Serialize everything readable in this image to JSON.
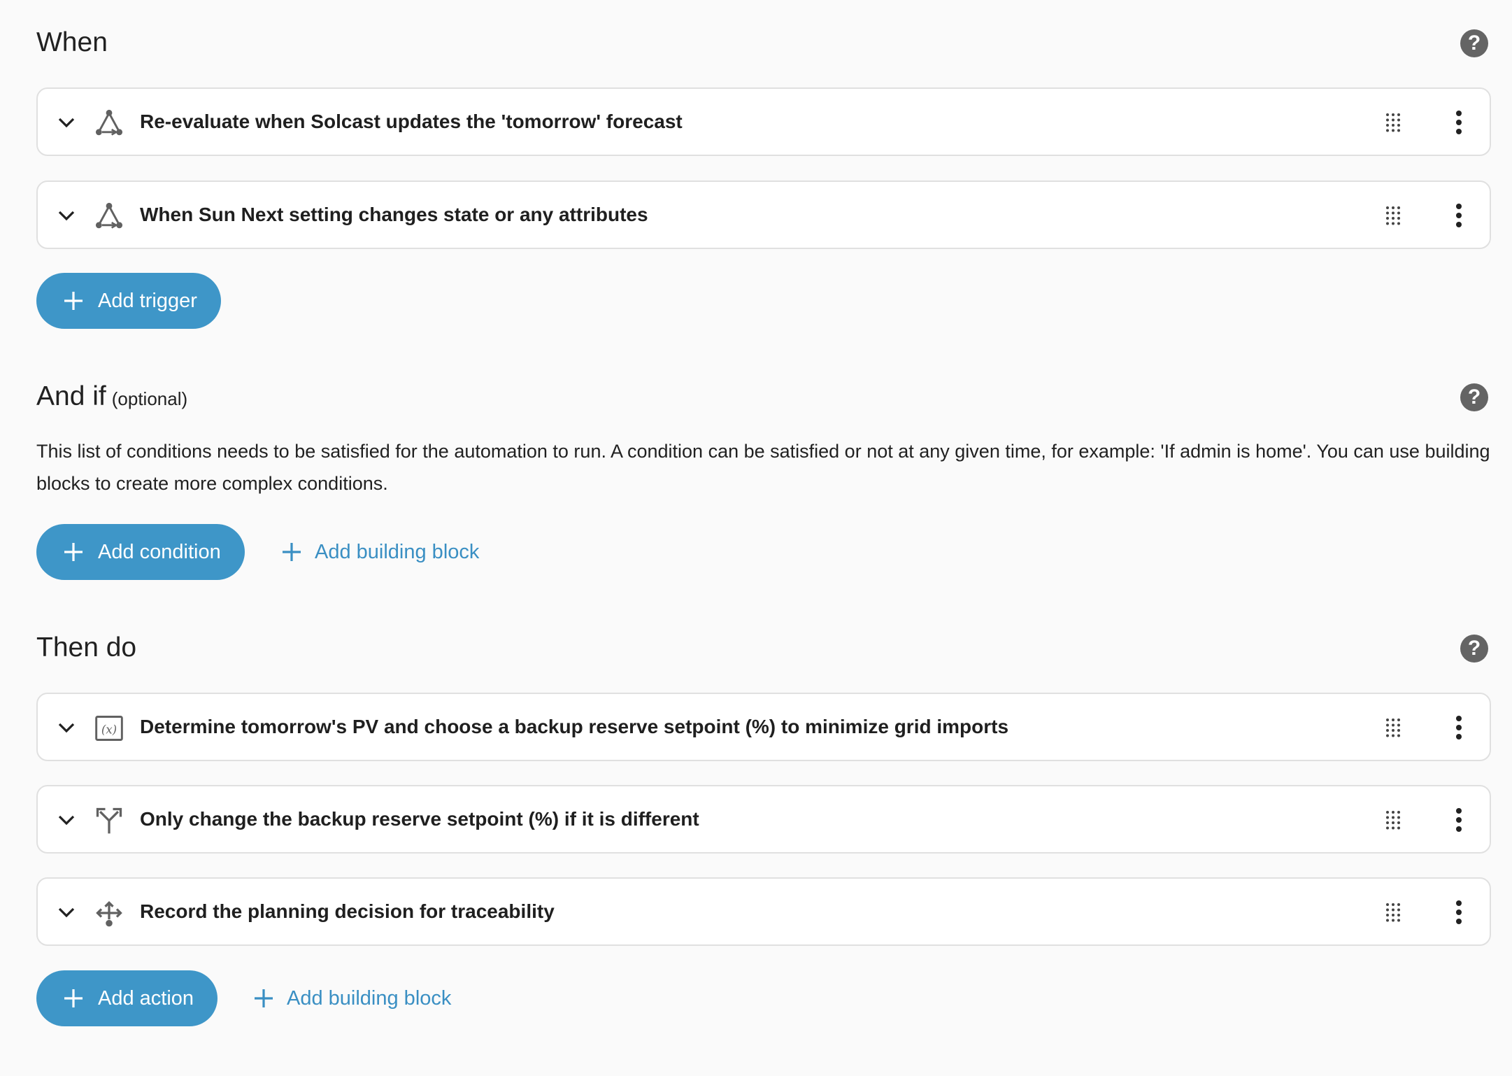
{
  "when": {
    "title": "When",
    "triggers": [
      {
        "label": "Re-evaluate when Solcast updates the 'tomorrow' forecast",
        "icon": "state-trigger-icon"
      },
      {
        "label": "When Sun Next setting changes state or any attributes",
        "icon": "state-trigger-icon"
      }
    ],
    "add_trigger_label": "Add trigger"
  },
  "and_if": {
    "title": "And if",
    "optional": "(optional)",
    "description": "This list of conditions needs to be satisfied for the automation to run. A condition can be satisfied or not at any given time, for example: 'If admin is home'. You can use building blocks to create more complex conditions.",
    "add_condition_label": "Add condition",
    "add_building_block_label": "Add building block"
  },
  "then_do": {
    "title": "Then do",
    "actions": [
      {
        "label": "Determine tomorrow's PV and choose a backup reserve setpoint (%) to minimize grid imports",
        "icon": "variables-icon"
      },
      {
        "label": "Only change the backup reserve setpoint (%) if it is different",
        "icon": "choose-icon"
      },
      {
        "label": "Record the planning decision for traceability",
        "icon": "event-icon"
      }
    ],
    "add_action_label": "Add action",
    "add_building_block_label": "Add building block"
  },
  "colors": {
    "accent": "#3e96c8",
    "text_link": "#3a8fc3",
    "help_icon": "#646464",
    "border": "#e0e0e0"
  }
}
